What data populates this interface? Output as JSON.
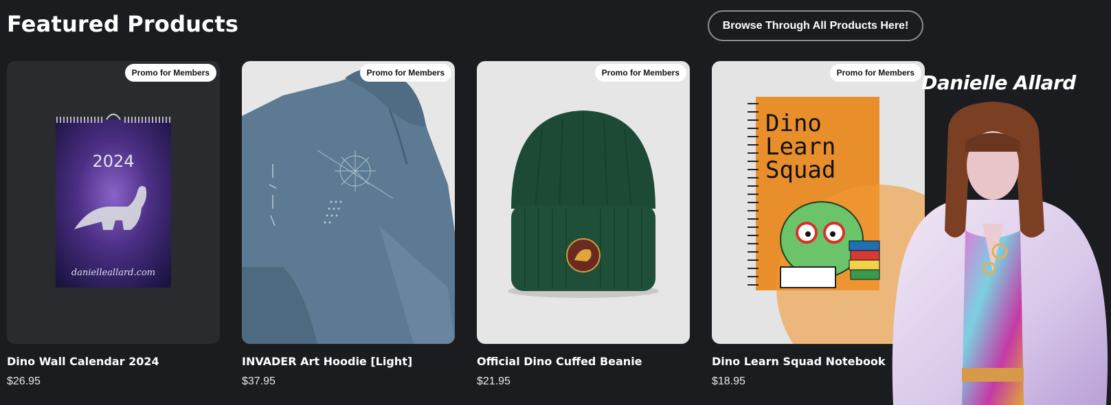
{
  "section": {
    "title": "Featured Products",
    "browse_label": "Browse Through All Products Here!"
  },
  "products": [
    {
      "name": "Dino Wall Calendar 2024",
      "price": "$26.95",
      "badge": "Promo for Members"
    },
    {
      "name": "INVADER Art Hoodie [Light]",
      "price": "$37.95",
      "badge": "Promo for Members"
    },
    {
      "name": "Official Dino Cuffed Beanie",
      "price": "$21.95",
      "badge": "Promo for Members"
    },
    {
      "name": "Dino Learn Squad Notebook",
      "price": "$18.95",
      "badge": "Promo for Members"
    }
  ],
  "calendar": {
    "year": "2024",
    "site": "danielleallard.com"
  },
  "notebook": {
    "line1": "Dino",
    "line2": "Learn",
    "line3": "Squad"
  },
  "promo": {
    "name": "Danielle Allard"
  },
  "icons": {
    "product-1": "calendar-image",
    "product-2": "hoodie-image",
    "product-3": "beanie-image",
    "product-4": "notebook-image",
    "promo": "person-photo"
  },
  "colors": {
    "background": "#1b1c1f",
    "badge_bg": "#ffffff",
    "button_border": "#8b8c90"
  }
}
